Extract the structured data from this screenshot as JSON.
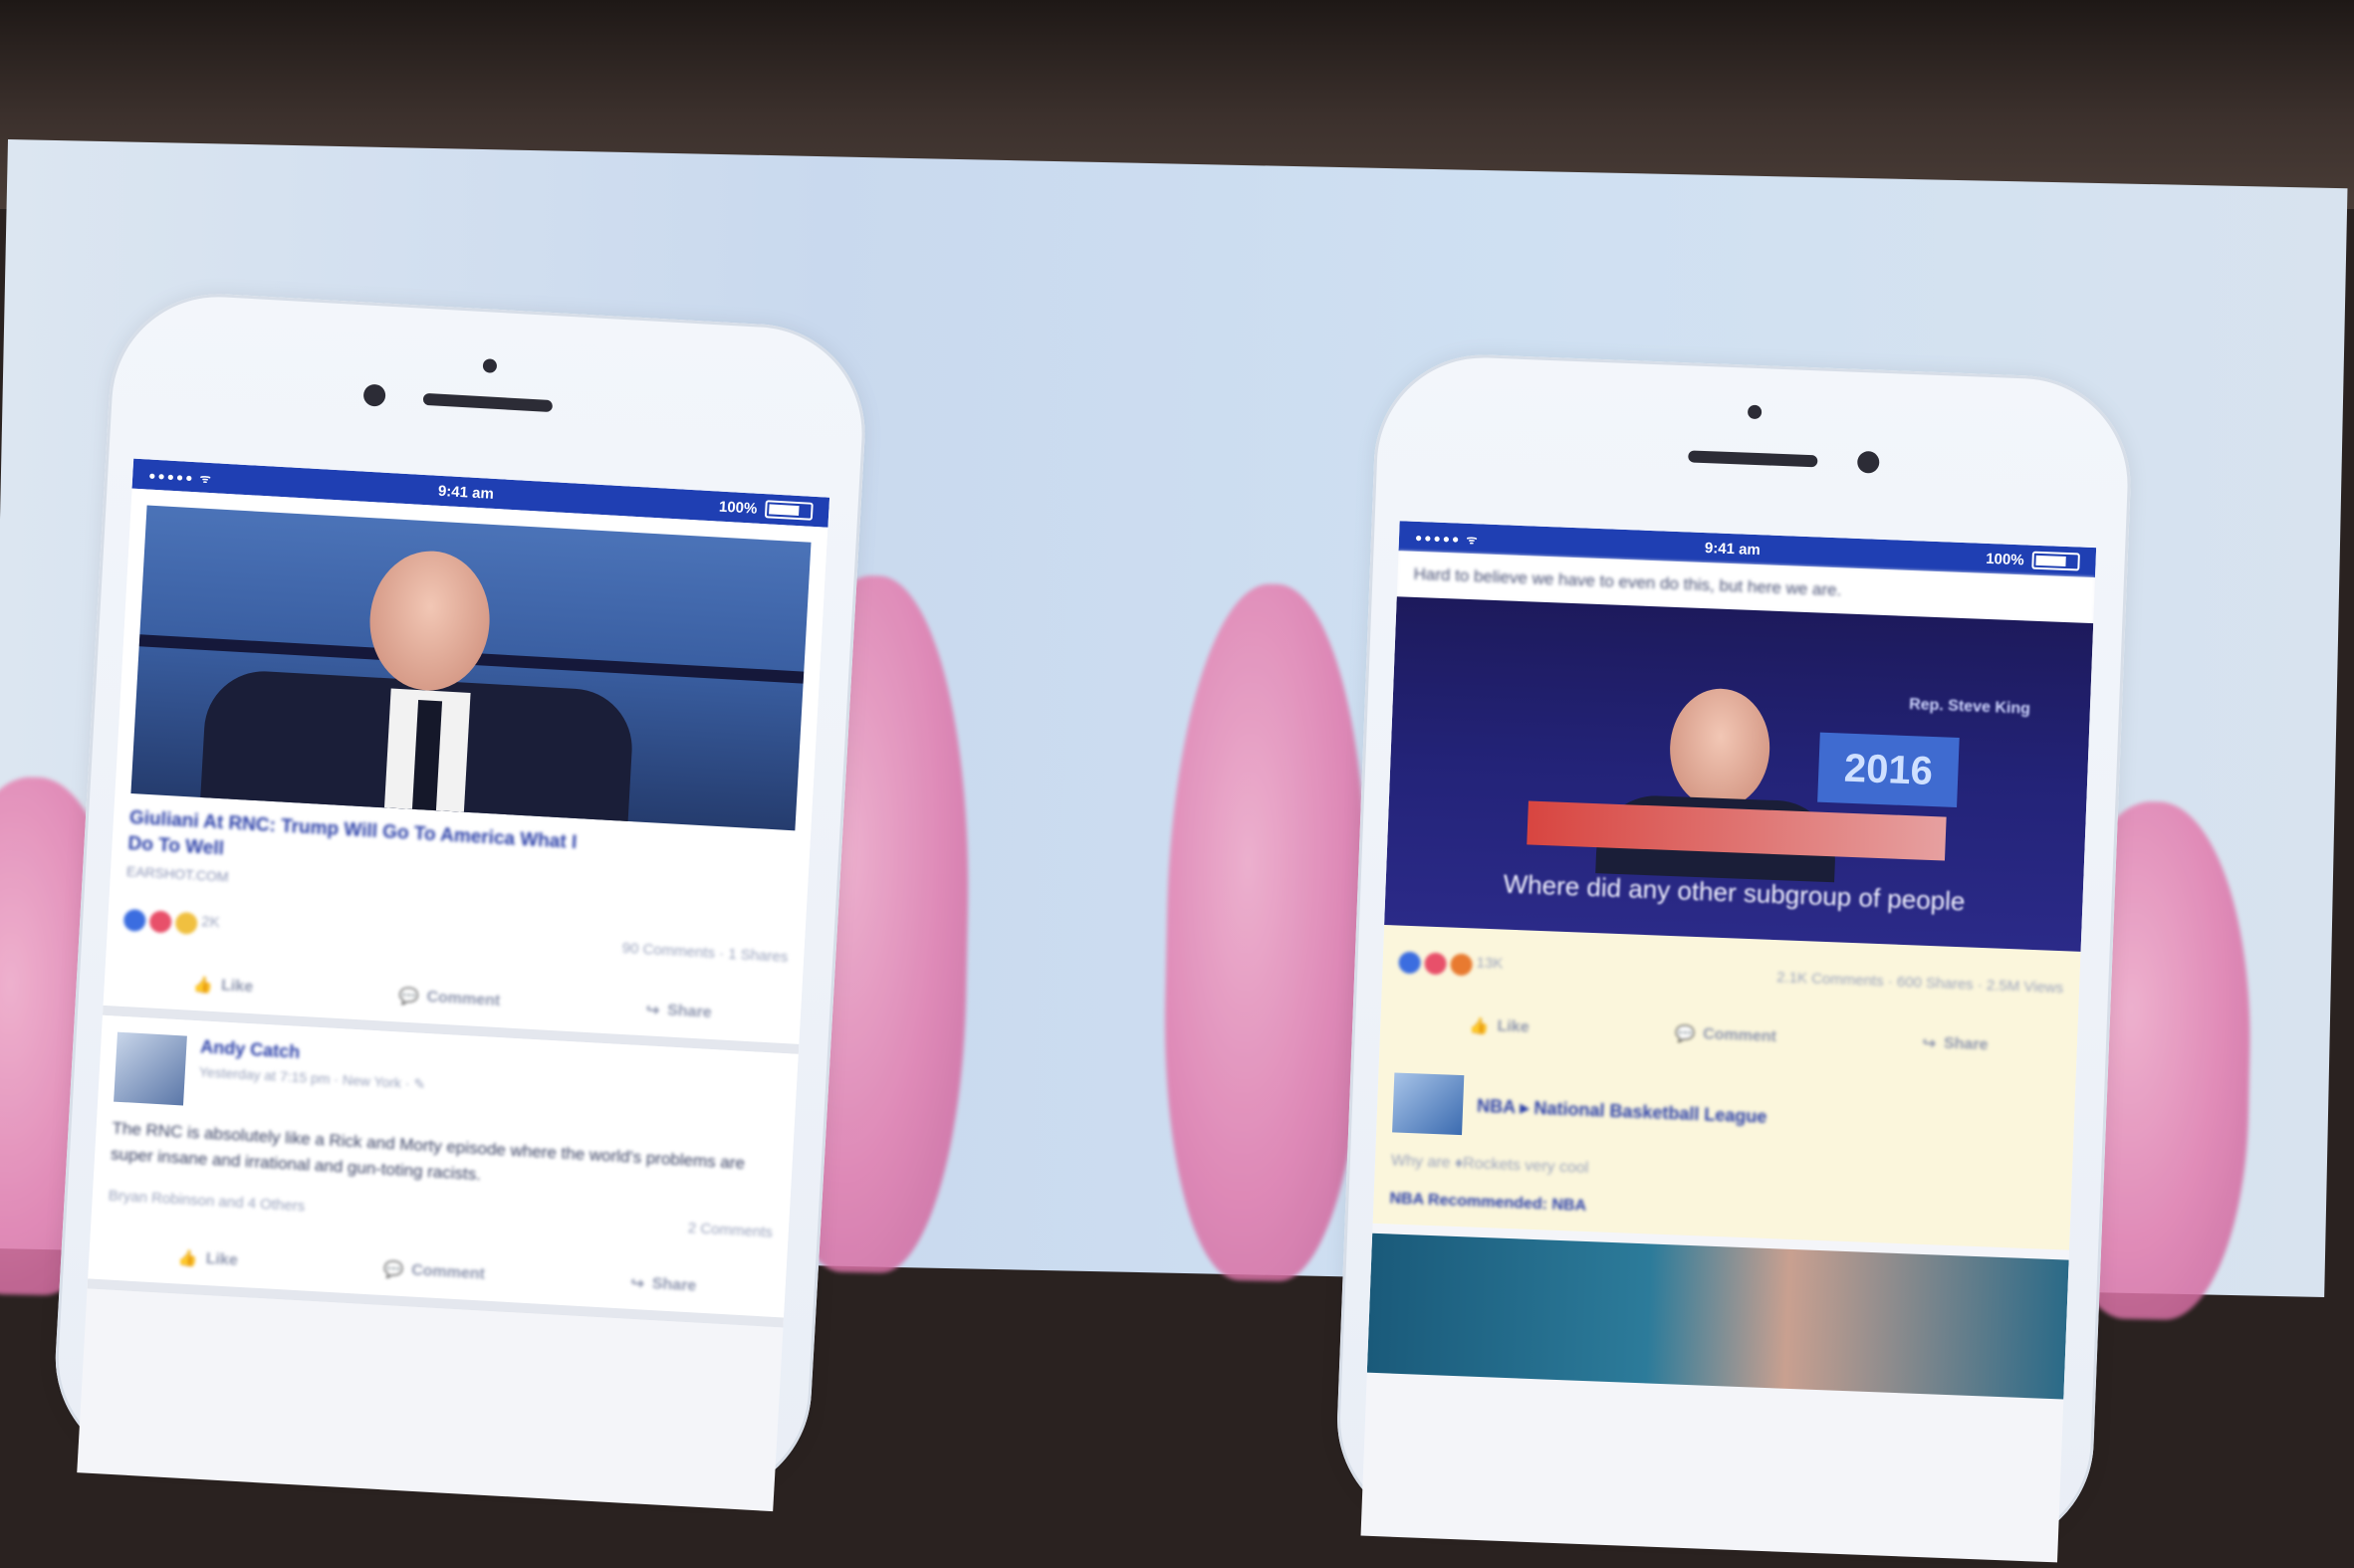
{
  "colors": {
    "fb_blue": "#1f3fb3",
    "link_blue": "#2a3fa8"
  },
  "left_phone": {
    "status": {
      "carrier": "●●●●● ᯤ",
      "time": "9:41 am",
      "battery": "100%"
    },
    "post1": {
      "title_line1": "Giuliani At RNC: Trump Will Go To America What I",
      "title_line2": "Do To Well",
      "source": "EARSHOT.COM",
      "reaction_count": "2K",
      "comments_shares": "90 Comments · 1 Shares",
      "actions": {
        "like": "Like",
        "comment": "Comment",
        "share": "Share"
      }
    },
    "post2": {
      "author": "Andy Catch",
      "meta": "Yesterday at 7:15 pm · New York · ✎",
      "text": "The RNC is absolutely like a Rick and Morty episode where the world's problems are super insane and irrational and gun-toting racists.",
      "likes_line": "Bryan Robinson and 4 Others",
      "comments": "2 Comments",
      "actions": {
        "like": "Like",
        "comment": "Comment",
        "share": "Share"
      }
    }
  },
  "right_phone": {
    "status": {
      "carrier": "●●●●● ᯤ",
      "time": "9:41 am",
      "battery": "100%"
    },
    "caption": "Hard to believe we have to even do this, but here we are.",
    "video": {
      "tag": "Rep. Steve King",
      "year": "2016",
      "subtitle": "Where did any other subgroup of people"
    },
    "reactions": {
      "count": "13K",
      "comments_shares": "2.1K Comments · 600 Shares · 2.5M Views"
    },
    "actions": {
      "like": "Like",
      "comment": "Comment",
      "share": "Share"
    },
    "page": {
      "name": "NBA ▸ National Basketball League",
      "line1": "Why are ♦Rockets very cool",
      "line2": "NBA Recommended: NBA"
    }
  }
}
